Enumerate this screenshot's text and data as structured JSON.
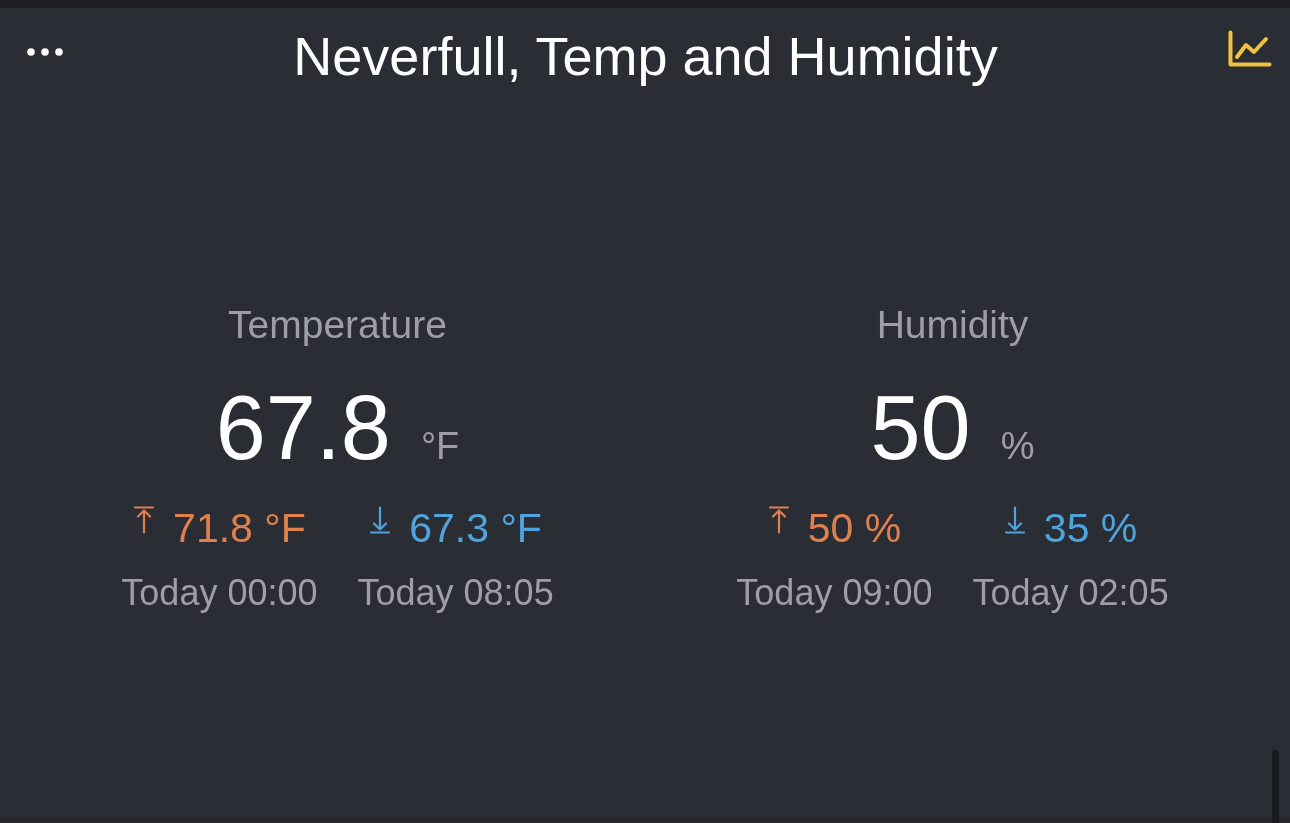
{
  "header": {
    "title": "Neverfull, Temp and Humidity"
  },
  "sensors": [
    {
      "label": "Temperature",
      "value": "67.8",
      "unit": "°F",
      "extremes": [
        {
          "kind": "high",
          "reading": "71.8 °F",
          "time": "Today 00:00"
        },
        {
          "kind": "low",
          "reading": "67.3 °F",
          "time": "Today 08:05"
        }
      ]
    },
    {
      "label": "Humidity",
      "value": "50",
      "unit": "%",
      "extremes": [
        {
          "kind": "high",
          "reading": "50 %",
          "time": "Today 09:00"
        },
        {
          "kind": "low",
          "reading": "35 %",
          "time": "Today 02:05"
        }
      ]
    }
  ]
}
